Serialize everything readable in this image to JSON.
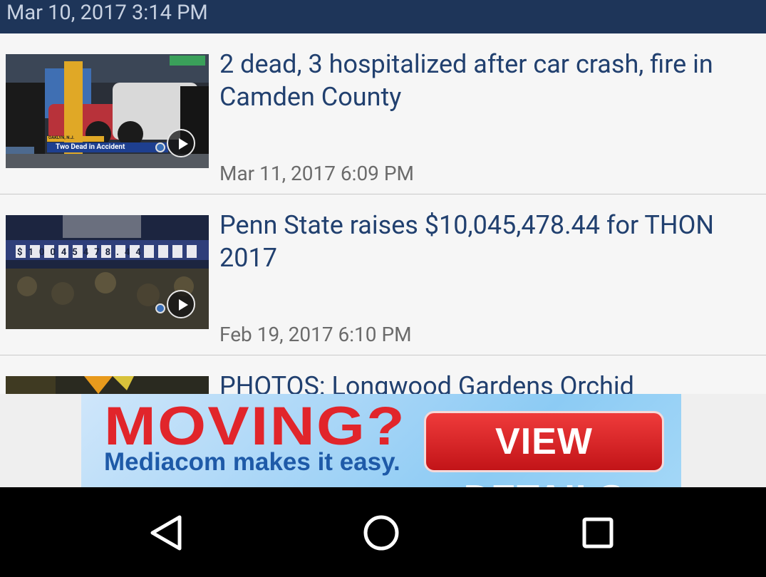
{
  "status": {
    "previous_timestamp": "Mar 10, 2017 3:14 PM"
  },
  "articles": [
    {
      "headline": "2 dead, 3 hospitalized after car crash, fire in Camden County",
      "date": "Mar 11, 2017 6:09 PM",
      "thumbnail_caption": "Two Dead in Accident",
      "thumbnail_tag": "OAKLYN, N.J."
    },
    {
      "headline": "Penn State raises $10,045,478.44 for THON 2017",
      "date": "Feb 19, 2017 6:10 PM",
      "thumbnail_board": "$10045478.44"
    },
    {
      "headline": "PHOTOS: Longwood Gardens Orchid"
    }
  ],
  "ad": {
    "headline": "MOVING?",
    "subline": "Mediacom makes it easy.",
    "button_label": "VIEW DETAILS",
    "colors": {
      "headline": "#e1252b",
      "subline": "#1e5aa8",
      "button": "#d2181c"
    }
  },
  "nav": {
    "back_icon": "back-triangle-icon",
    "home_icon": "home-circle-icon",
    "recents_icon": "recents-square-icon"
  },
  "colors": {
    "top_bar": "#1e3559",
    "headline": "#21406f",
    "date": "#6b6b6b",
    "background": "#f6f6f6"
  }
}
